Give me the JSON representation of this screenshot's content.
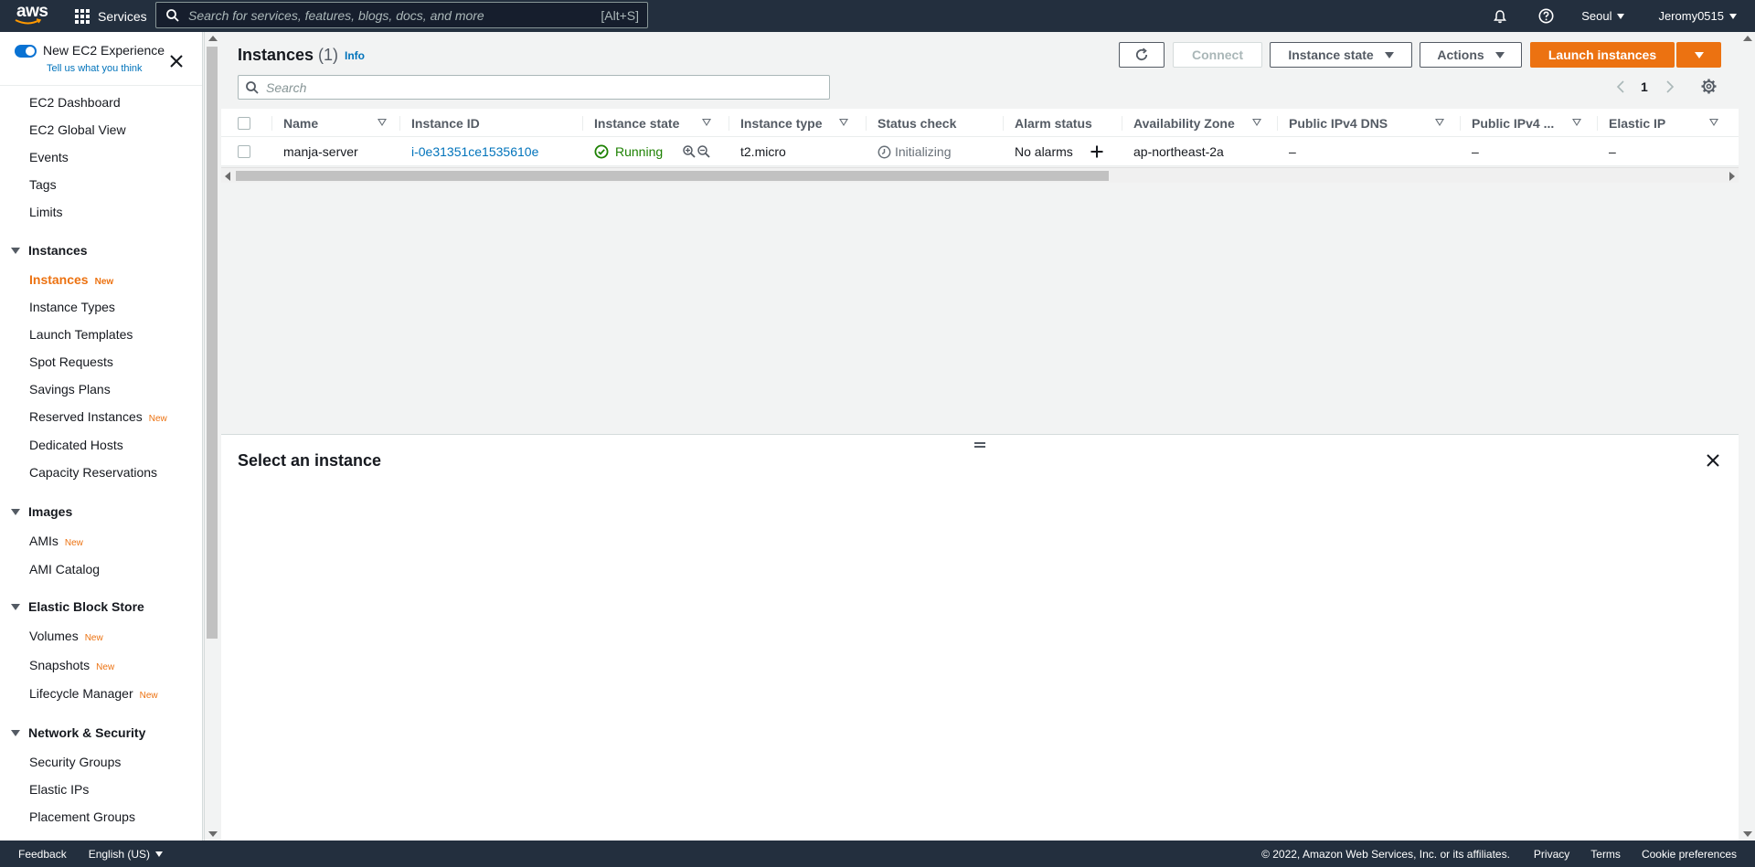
{
  "topnav": {
    "logo_text": "aws",
    "services_label": "Services",
    "search_placeholder": "Search for services, features, blogs, docs, and more",
    "search_shortcut": "[Alt+S]",
    "region": "Seoul",
    "user": "Jeromy0515",
    "icons": [
      "grid-icon",
      "search-icon",
      "bell-icon",
      "help-icon"
    ]
  },
  "sidebar": {
    "experience_label": "New EC2 Experience",
    "experience_link": "Tell us what you think",
    "top_items": [
      "EC2 Dashboard",
      "EC2 Global View",
      "Events",
      "Tags",
      "Limits"
    ],
    "sections": [
      {
        "title": "Instances",
        "items": [
          {
            "label": "Instances",
            "badge": "New",
            "active": true
          },
          {
            "label": "Instance Types",
            "badge": ""
          },
          {
            "label": "Launch Templates",
            "badge": ""
          },
          {
            "label": "Spot Requests",
            "badge": ""
          },
          {
            "label": "Savings Plans",
            "badge": ""
          },
          {
            "label": "Reserved Instances",
            "badge": "New"
          },
          {
            "label": "Dedicated Hosts",
            "badge": ""
          },
          {
            "label": "Capacity Reservations",
            "badge": ""
          }
        ]
      },
      {
        "title": "Images",
        "items": [
          {
            "label": "AMIs",
            "badge": "New"
          },
          {
            "label": "AMI Catalog",
            "badge": ""
          }
        ]
      },
      {
        "title": "Elastic Block Store",
        "items": [
          {
            "label": "Volumes",
            "badge": "New"
          },
          {
            "label": "Snapshots",
            "badge": "New"
          },
          {
            "label": "Lifecycle Manager",
            "badge": "New"
          }
        ]
      },
      {
        "title": "Network & Security",
        "items": [
          {
            "label": "Security Groups",
            "badge": ""
          },
          {
            "label": "Elastic IPs",
            "badge": ""
          },
          {
            "label": "Placement Groups",
            "badge": ""
          }
        ]
      }
    ]
  },
  "main": {
    "title": "Instances",
    "count": "(1)",
    "info": "Info",
    "buttons": {
      "connect": "Connect",
      "instance_state": "Instance state",
      "actions": "Actions",
      "launch": "Launch instances"
    },
    "search_placeholder": "Search",
    "page": "1",
    "table": {
      "columns": [
        "Name",
        "Instance ID",
        "Instance state",
        "Instance type",
        "Status check",
        "Alarm status",
        "Availability Zone",
        "Public IPv4 DNS",
        "Public IPv4 ...",
        "Elastic IP"
      ],
      "rows": [
        {
          "name": "manja-server",
          "instance_id": "i-0e31351ce1535610e",
          "state": "Running",
          "type": "t2.micro",
          "status_check": "Initializing",
          "alarm": "No alarms",
          "az": "ap-northeast-2a",
          "ipv4_dns": "–",
          "ipv4": "–",
          "elastic_ip": "–"
        }
      ]
    },
    "split_title": "Select an instance"
  },
  "footer": {
    "feedback": "Feedback",
    "language": "English (US)",
    "copyright": "© 2022, Amazon Web Services, Inc. or its affiliates.",
    "privacy": "Privacy",
    "terms": "Terms",
    "cookies": "Cookie preferences"
  },
  "colors": {
    "nav_bg": "#232f3e",
    "accent": "#ec7211",
    "link": "#0073bb",
    "running": "#1d8102"
  }
}
